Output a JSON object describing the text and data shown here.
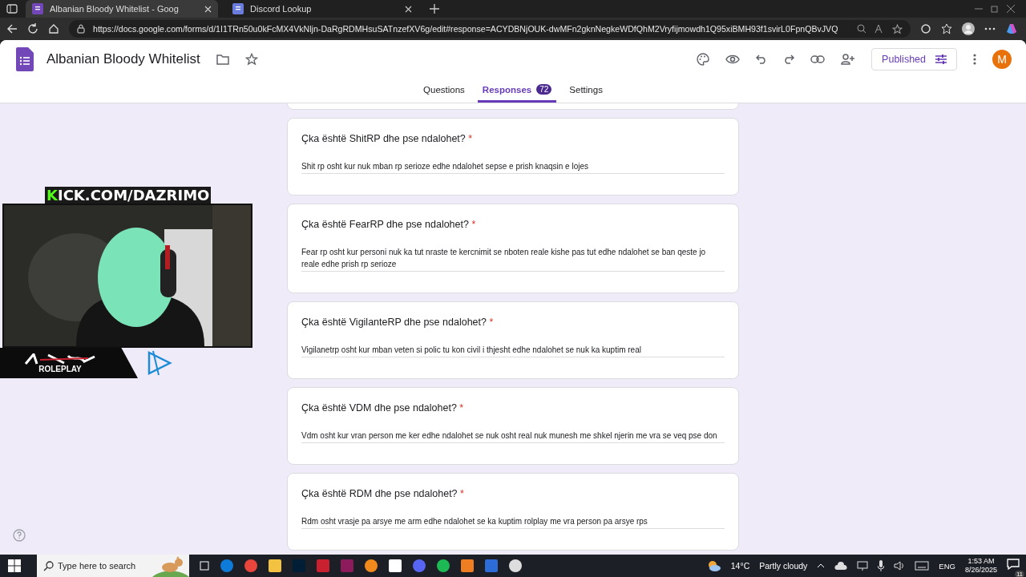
{
  "browser": {
    "tabs": [
      {
        "title": "Albanian Bloody Whitelist - Goog",
        "selected": true
      },
      {
        "title": "Discord Lookup",
        "selected": false
      }
    ],
    "url": "https://docs.google.com/forms/d/1I1TRn50u0kFcMX4VkNljn-DaRgRDMHsuSATnzefXV6g/edit#response=ACYDBNjOUK-dwMFn2gknNegkeWDfQhM2Vryfijmowdh1Q95xiBMH93f1svirL0FpnQBvJVQ"
  },
  "form": {
    "title": "Albanian Bloody Whitelist",
    "publish_button": "Published",
    "avatar": "M",
    "tabs": [
      {
        "label": "Questions",
        "selected": false
      },
      {
        "label": "Responses",
        "selected": true,
        "badge": "72"
      },
      {
        "label": "Settings",
        "selected": false
      }
    ]
  },
  "questions": [
    {
      "title": "Çka është ShitRP dhe pse ndalohet?",
      "required_mark": "*",
      "answer": "Shit rp osht kur nuk mban rp serioze edhe ndalohet sepse e prish knaqsin e lojes"
    },
    {
      "title": "Çka është FearRP dhe pse ndalohet?",
      "required_mark": "*",
      "answer": "Fear rp osht kur personi nuk ka tut nraste te kercnimit se nboten reale kishe pas tut edhe ndalohet se ban qeste jo reale edhe prish rp serioze"
    },
    {
      "title": "Çka është VigilanteRP dhe pse ndalohet?",
      "required_mark": "*",
      "answer": "Vigilanetrp osht kur mban veten si polic tu kon civil i thjesht edhe ndalohet se nuk ka kuptim real"
    },
    {
      "title": "Çka është VDM dhe pse ndalohet?",
      "required_mark": "*",
      "answer": "Vdm osht kur vran person me ker edhe ndalohet se nuk osht real nuk munesh me shkel njerin me vra se veq pse don"
    },
    {
      "title": "Çka është RDM dhe pse ndalohet?",
      "required_mark": "*",
      "answer": "Rdm osht vrasje pa arsye me arm edhe ndalohet se ka kuptim rolplay me vra person pa arsye rps"
    }
  ],
  "overlay": {
    "banner": "KICK.COM/DAZRIMO",
    "logo_caption": "ROLEPLAY"
  },
  "taskbar": {
    "search_placeholder": "Type here to search",
    "temperature": "14°C",
    "weather": "Partly cloudy",
    "language": "ENG",
    "time": "1:53 AM",
    "date": "8/26/2025",
    "notifications": "11"
  }
}
